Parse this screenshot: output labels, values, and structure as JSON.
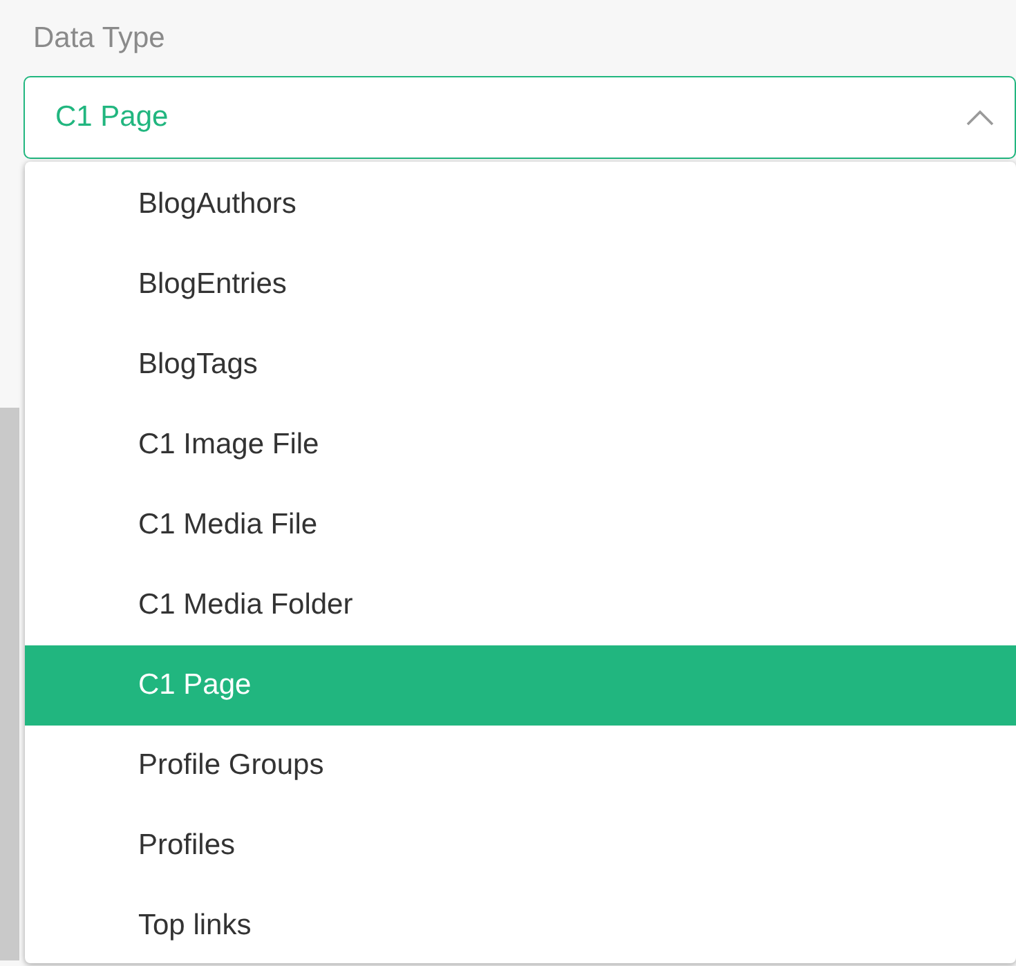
{
  "field": {
    "label": "Data Type",
    "value": "C1 Page",
    "expanded": true
  },
  "options": [
    {
      "label": "BlogAuthors",
      "selected": false
    },
    {
      "label": "BlogEntries",
      "selected": false
    },
    {
      "label": "BlogTags",
      "selected": false
    },
    {
      "label": "C1 Image File",
      "selected": false
    },
    {
      "label": "C1 Media File",
      "selected": false
    },
    {
      "label": "C1 Media Folder",
      "selected": false
    },
    {
      "label": "C1 Page",
      "selected": true
    },
    {
      "label": "Profile Groups",
      "selected": false
    },
    {
      "label": "Profiles",
      "selected": false
    },
    {
      "label": "Top links",
      "selected": false
    }
  ]
}
